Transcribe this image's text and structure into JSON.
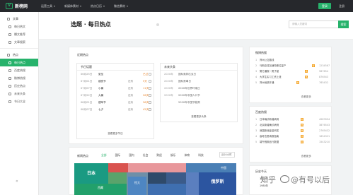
{
  "brand": {
    "logo_mark": "V",
    "name": "新榜网"
  },
  "topnav": [
    "运营工具",
    "新媒体素材",
    "热点日历",
    "微信素材"
  ],
  "auth": {
    "login": "登录",
    "register": "注册"
  },
  "sidebar": {
    "section1": "文章",
    "section1_items": [
      "每日热文",
      "爆文推荐",
      "文章搜索"
    ],
    "section2": "热点",
    "section2_items": [
      "每日热点",
      "百度热搜",
      "微博热搜",
      "历史热点",
      "未来头条",
      "节日大全"
    ],
    "active_item": "每日热点",
    "collapse": "«"
  },
  "hero": {
    "title": "选题 · 每日热点",
    "search_placeholder": "请输入关键词",
    "search_btn": "搜索"
  },
  "left_card": {
    "title": "近期热点",
    "festivals": {
      "title": "节日话题",
      "rows": [
        {
          "date": "06月25日",
          "name": "夏至",
          "tag": "",
          "days": "已过"
        },
        {
          "date": "07月01日",
          "name": "建党节",
          "tag": "还有",
          "days": "5天"
        },
        {
          "date": "07月07日",
          "name": "小暑",
          "tag": "还有",
          "days": "11天"
        },
        {
          "date": "07月22日",
          "name": "大暑",
          "tag": "还有",
          "days": "26天"
        },
        {
          "date": "08月01日",
          "name": "建军节",
          "tag": "还有",
          "days": "36天"
        },
        {
          "date": "08月07日",
          "name": "七夕",
          "tag": "还有",
          "days": "42天"
        }
      ],
      "more": "查看更多节日"
    },
    "history": {
      "title": "未来头条",
      "rows": [
        {
          "year": "2020年",
          "text": "国际奥林匹克日"
        },
        {
          "year": "2020年",
          "text": "国际禁毒日"
        },
        {
          "year": "2020年",
          "text": "2020年世界环境日"
        },
        {
          "year": "2020年",
          "text": "2020年中国人口节"
        },
        {
          "year": "",
          "text": "2020年中国节能周"
        }
      ],
      "more": "查看更多头条"
    }
  },
  "weibo_panel": {
    "title": "微博热搜",
    "rows": [
      {
        "num": "1",
        "text": "郑州公交路线",
        "val": "",
        "tag": ""
      },
      {
        "num": "2",
        "text": "马斯克将加速特斯拉量产",
        "val": "1234567",
        "tag": "新"
      },
      {
        "num": "3",
        "text": "警方通报一男子被",
        "val": "987654",
        "tag": "热"
      },
      {
        "num": "4",
        "text": "大学生实习工资上涨",
        "val": "876543",
        "tag": "热"
      },
      {
        "num": "5",
        "text": "郑州地铁开通",
        "val": "765432",
        "tag": "热"
      }
    ],
    "more": "查看更多"
  },
  "baidu_panel": {
    "title": "百度热搜",
    "rows": [
      {
        "num": "1",
        "text": "日本确诊新增病例",
        "val": "4987654",
        "tag": "新"
      },
      {
        "num": "2",
        "text": "北京新增确诊病例",
        "val": "3876543",
        "tag": "热"
      },
      {
        "num": "3",
        "text": "我国新冠疫苗研发",
        "val": "2765432",
        "tag": "热"
      },
      {
        "num": "4",
        "text": "高考志愿填报指南",
        "val": "1654321",
        "tag": "热"
      },
      {
        "num": "5",
        "text": "端午假期出行数据",
        "val": "1543210",
        "tag": "新"
      }
    ],
    "more": "查看更多"
  },
  "history_panel": {
    "title": "历史今天",
    "rows": [
      "1970年",
      "1980年"
    ]
  },
  "bottom_card": {
    "title": "新闻热点",
    "tabs": [
      "全部",
      "国际",
      "国内",
      "社会",
      "财经",
      "娱乐",
      "体育",
      "科技"
    ],
    "active_tab": "全部",
    "select": "近24小时",
    "tiles": [
      {
        "label": "日本",
        "color": "#1a9a82"
      },
      {
        "label": "",
        "color": "#d9534f"
      },
      {
        "label": "",
        "color": "#e8979b"
      },
      {
        "label": "中国",
        "color": "#4a7fb5"
      },
      {
        "label": "",
        "color": "#5aa36b"
      },
      {
        "label": "西藏",
        "color": "#22a06b"
      },
      {
        "label": "",
        "color": "#6f8fa8"
      },
      {
        "label": "恒大",
        "color": "#4e86c2"
      },
      {
        "label": "",
        "color": "#2f4a6a"
      },
      {
        "label": "",
        "color": "#3b5b8a"
      },
      {
        "label": "",
        "color": "#3f6fb0"
      },
      {
        "label": "",
        "color": "#5b7fbf"
      },
      {
        "label": "俄罗斯",
        "color": "#2c55a0"
      }
    ]
  },
  "watermark": {
    "brand": "知乎",
    "author": "@有号以后"
  },
  "colors": {
    "brand_green": "#27b26b",
    "topbar": "#26282c"
  }
}
